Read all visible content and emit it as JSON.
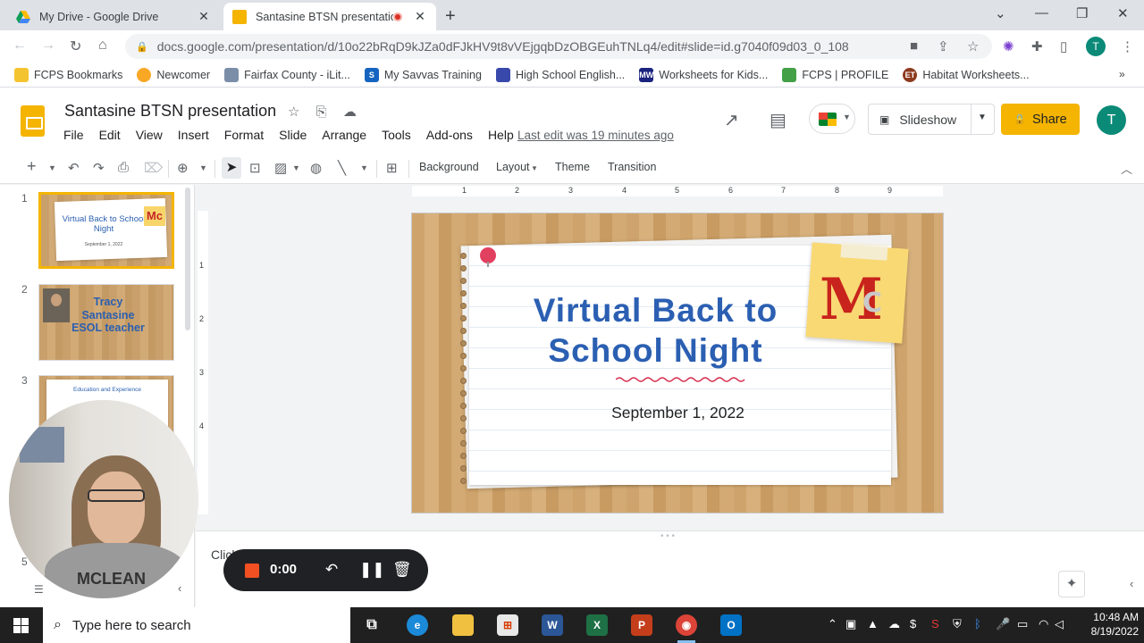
{
  "browser": {
    "tabs": [
      {
        "title": "My Drive - Google Drive",
        "active": false
      },
      {
        "title": "Santasine BTSN presentation",
        "active": true,
        "recording": true
      }
    ],
    "url": "docs.google.com/presentation/d/10o22bRqD9kJZa0dFJkHV9t8vVEjgqbDzOBGEuhTNLq4/edit#slide=id.g7040f09d03_0_108",
    "profile_initial": "T",
    "bookmarks": [
      {
        "label": "FCPS Bookmarks",
        "icon": "folder-icon",
        "color": "#f4c430"
      },
      {
        "label": "Newcomer",
        "icon": "emoji-icon",
        "color": "#f9a825"
      },
      {
        "label": "Fairfax County - iLit...",
        "icon": "book-icon",
        "color": "#7b8ea8"
      },
      {
        "label": "My Savvas Training",
        "icon": "savvas-icon",
        "color": "#1565c0"
      },
      {
        "label": "High School English...",
        "icon": "calendar-icon",
        "color": "#3949ab"
      },
      {
        "label": "Worksheets for Kids...",
        "icon": "mw-icon",
        "color": "#1a237e"
      },
      {
        "label": "FCPS | PROFILE",
        "icon": "profile-icon",
        "color": "#43a047"
      },
      {
        "label": "Habitat Worksheets...",
        "icon": "et-icon",
        "color": "#8d3b1f"
      }
    ]
  },
  "doc": {
    "title": "Santasine BTSN presentation",
    "menu": [
      "File",
      "Edit",
      "View",
      "Insert",
      "Format",
      "Slide",
      "Arrange",
      "Tools",
      "Add-ons",
      "Help"
    ],
    "last_edit": "Last edit was 19 minutes ago",
    "slideshow_label": "Slideshow",
    "share_label": "Share",
    "avatar_initial": "T"
  },
  "toolbar": {
    "background_label": "Background",
    "layout_label": "Layout",
    "theme_label": "Theme",
    "transition_label": "Transition"
  },
  "ruler": {
    "h_marks": [
      "1",
      "2",
      "3",
      "4",
      "5",
      "6",
      "7",
      "8",
      "9"
    ],
    "v_marks": [
      "1",
      "2",
      "3",
      "4"
    ]
  },
  "filmstrip": {
    "slides": [
      {
        "num": "1",
        "title": "Virtual Back to School Night",
        "sub": "September 1, 2022",
        "logo": "Mc"
      },
      {
        "num": "2",
        "title": "Tracy Santasine ESOL teacher"
      },
      {
        "num": "3",
        "title": "Education and Experience"
      }
    ],
    "last_num": "5"
  },
  "slide": {
    "title_line1": "Virtual Back to",
    "title_line2": "School Night",
    "date": "September 1, 2022",
    "logo_m": "M",
    "logo_c": "C"
  },
  "notes": {
    "placeholder": "Click to add speaker notes"
  },
  "recorder": {
    "time": "0:00"
  },
  "webcam": {
    "shirt_text": "MCLEAN"
  },
  "taskbar": {
    "search_placeholder": "Type here to search",
    "time": "10:48 AM",
    "date": "8/19/2022"
  }
}
